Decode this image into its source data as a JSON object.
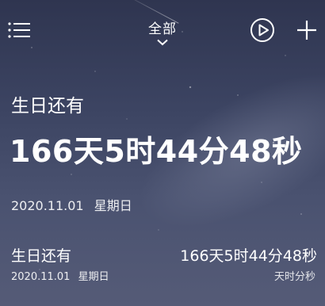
{
  "header": {
    "category_label": "全部",
    "icons": {
      "menu": "menu-icon",
      "dropdown": "chevron-down-icon",
      "play": "play-circle-icon",
      "add": "plus-icon"
    }
  },
  "hero": {
    "title": "生日还有",
    "countdown": "166天5时44分48秒",
    "date": "2020.11.01",
    "weekday": "星期日"
  },
  "events": [
    {
      "title": "生日还有",
      "date": "2020.11.01",
      "weekday": "星期日",
      "countdown": "166天5时44分48秒",
      "unit": "天时分秒"
    }
  ],
  "colors": {
    "text": "#ffffff",
    "sky_top": "#2f3550",
    "sky_bottom": "#555b77"
  }
}
